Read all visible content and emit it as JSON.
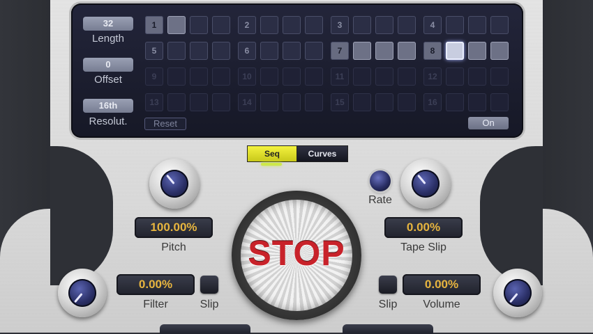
{
  "sequencer": {
    "length": {
      "value": "32",
      "label": "Length"
    },
    "offset": {
      "value": "0",
      "label": "Offset"
    },
    "resolution": {
      "value": "16th",
      "label": "Resolut."
    },
    "reset_label": "Reset",
    "on_label": "On",
    "group_numbers": [
      "1",
      "2",
      "3",
      "4",
      "5",
      "6",
      "7",
      "8",
      "9",
      "10",
      "11",
      "12",
      "13",
      "14",
      "15",
      "16"
    ]
  },
  "mode_tabs": {
    "seq": "Seq",
    "curves": "Curves"
  },
  "pitch": {
    "value": "100.00%",
    "label": "Pitch"
  },
  "tape_slip": {
    "value": "0.00%",
    "label": "Tape Slip"
  },
  "rate": {
    "label": "Rate"
  },
  "stop": {
    "label": "STOP"
  },
  "filter": {
    "value": "0.00%",
    "label": "Filter",
    "slip_label": "Slip"
  },
  "volume": {
    "value": "0.00%",
    "label": "Volume",
    "slip_label": "Slip"
  },
  "colors": {
    "value_text": "#e7b53f",
    "seq_tab": "#f4f33f",
    "stop_text": "#c8222a"
  }
}
